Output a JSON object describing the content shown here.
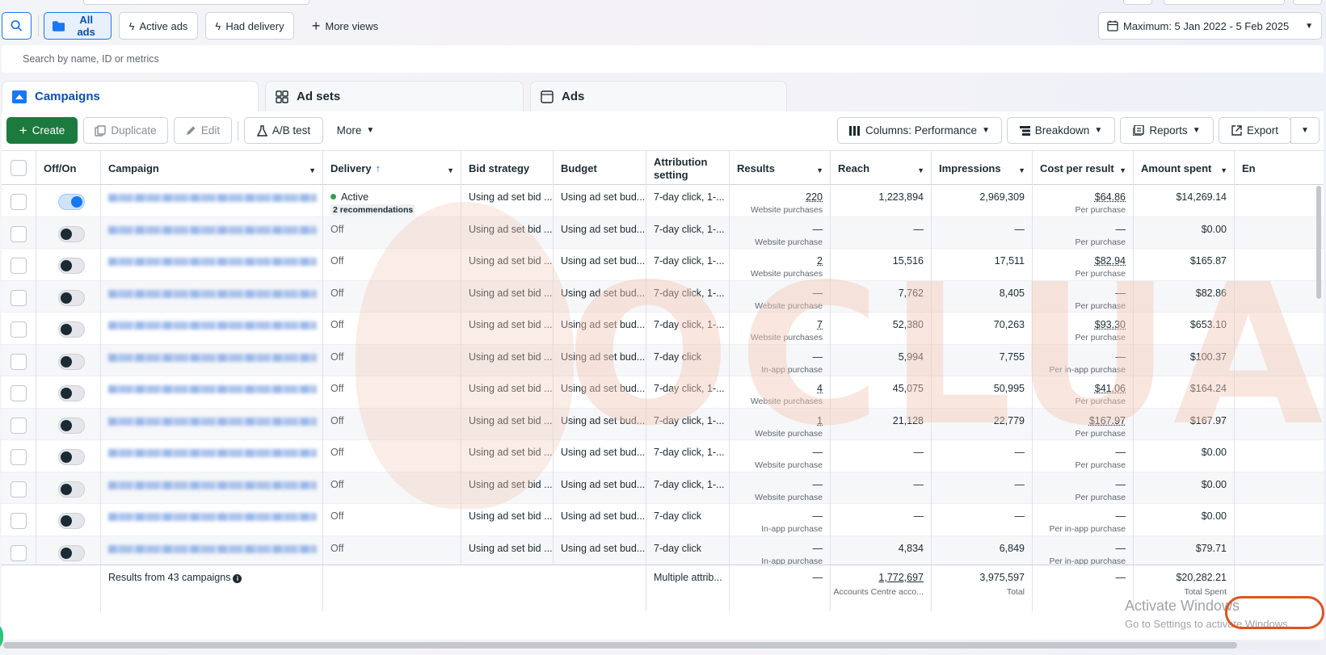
{
  "toolbar": {
    "all_ads": "All ads",
    "active_ads": "Active ads",
    "had_delivery": "Had delivery",
    "more_views": "More views",
    "date_range": "Maximum: 5 Jan 2022 - 5 Feb 2025"
  },
  "search": {
    "placeholder": "Search by name, ID or metrics"
  },
  "level_tabs": {
    "campaigns": "Campaigns",
    "ad_sets": "Ad sets",
    "ads": "Ads"
  },
  "actions": {
    "create": "Create",
    "duplicate": "Duplicate",
    "edit": "Edit",
    "ab_test": "A/B test",
    "more": "More",
    "columns": "Columns: Performance",
    "breakdown": "Breakdown",
    "reports": "Reports",
    "export": "Export"
  },
  "columns": {
    "off_on": "Off/On",
    "campaign": "Campaign",
    "delivery": "Delivery",
    "bid_strategy": "Bid strategy",
    "budget": "Budget",
    "attribution": "Attribution setting",
    "results": "Results",
    "reach": "Reach",
    "impressions": "Impressions",
    "cost_per_result": "Cost per result",
    "amount_spent": "Amount spent",
    "next_col": "En"
  },
  "rows": [
    {
      "on": true,
      "delivery": "Active",
      "recs": "2 recommendations",
      "bid": "Using ad set bid ...",
      "budget": "Using ad set bud...",
      "attr": "7-day click, 1-...",
      "results": "220",
      "results_sub": "Website purchases",
      "reach": "1,223,894",
      "impr": "2,969,309",
      "cpr": "$64.86",
      "cpr_sub": "Per purchase",
      "spent": "$14,269.14"
    },
    {
      "on": false,
      "delivery": "Off",
      "bid": "Using ad set bid ...",
      "budget": "Using ad set bud...",
      "attr": "7-day click, 1-...",
      "results": "—",
      "results_sub": "Website purchase",
      "reach": "—",
      "impr": "—",
      "cpr": "—",
      "cpr_sub": "Per purchase",
      "spent": "$0.00"
    },
    {
      "on": false,
      "delivery": "Off",
      "bid": "Using ad set bid ...",
      "budget": "Using ad set bud...",
      "attr": "7-day click, 1-...",
      "results": "2",
      "results_sub": "Website purchases",
      "reach": "15,516",
      "impr": "17,511",
      "cpr": "$82.94",
      "cpr_sub": "Per purchase",
      "spent": "$165.87"
    },
    {
      "on": false,
      "delivery": "Off",
      "bid": "Using ad set bid ...",
      "budget": "Using ad set bud...",
      "attr": "7-day click, 1-...",
      "results": "—",
      "results_sub": "Website purchase",
      "reach": "7,762",
      "impr": "8,405",
      "cpr": "—",
      "cpr_sub": "Per purchase",
      "spent": "$82.86"
    },
    {
      "on": false,
      "delivery": "Off",
      "bid": "Using ad set bid ...",
      "budget": "Using ad set bud...",
      "attr": "7-day click, 1-...",
      "results": "7",
      "results_sub": "Website purchases",
      "reach": "52,380",
      "impr": "70,263",
      "cpr": "$93.30",
      "cpr_sub": "Per purchase",
      "spent": "$653.10"
    },
    {
      "on": false,
      "delivery": "Off",
      "bid": "Using ad set bid ...",
      "budget": "Using ad set bud...",
      "attr": "7-day click",
      "results": "—",
      "results_sub": "In-app purchase",
      "reach": "5,994",
      "impr": "7,755",
      "cpr": "—",
      "cpr_sub": "Per in-app purchase",
      "spent": "$100.37"
    },
    {
      "on": false,
      "delivery": "Off",
      "bid": "Using ad set bid ...",
      "budget": "Using ad set bud...",
      "attr": "7-day click, 1-...",
      "results": "4",
      "results_sub": "Website purchases",
      "reach": "45,075",
      "impr": "50,995",
      "cpr": "$41.06",
      "cpr_sub": "Per purchase",
      "spent": "$164.24"
    },
    {
      "on": false,
      "delivery": "Off",
      "bid": "Using ad set bid ...",
      "budget": "Using ad set bud...",
      "attr": "7-day click, 1-...",
      "results": "1",
      "results_sub": "Website purchase",
      "reach": "21,128",
      "impr": "22,779",
      "cpr": "$167.97",
      "cpr_sub": "Per purchase",
      "spent": "$167.97"
    },
    {
      "on": false,
      "delivery": "Off",
      "bid": "Using ad set bid ...",
      "budget": "Using ad set bud...",
      "attr": "7-day click, 1-...",
      "results": "—",
      "results_sub": "Website purchase",
      "reach": "—",
      "impr": "—",
      "cpr": "—",
      "cpr_sub": "Per purchase",
      "spent": "$0.00"
    },
    {
      "on": false,
      "delivery": "Off",
      "bid": "Using ad set bid ...",
      "budget": "Using ad set bud...",
      "attr": "7-day click, 1-...",
      "results": "—",
      "results_sub": "Website purchase",
      "reach": "—",
      "impr": "—",
      "cpr": "—",
      "cpr_sub": "Per purchase",
      "spent": "$0.00"
    },
    {
      "on": false,
      "delivery": "Off",
      "bid": "Using ad set bid ...",
      "budget": "Using ad set bud...",
      "attr": "7-day click",
      "results": "—",
      "results_sub": "In-app purchase",
      "reach": "—",
      "impr": "—",
      "cpr": "—",
      "cpr_sub": "Per in-app purchase",
      "spent": "$0.00"
    },
    {
      "on": false,
      "delivery": "Off",
      "bid": "Using ad set bid ...",
      "budget": "Using ad set bud...",
      "attr": "7-day click",
      "results": "—",
      "results_sub": "In-app purchase",
      "reach": "4,834",
      "impr": "6,849",
      "cpr": "—",
      "cpr_sub": "Per in-app purchase",
      "spent": "$79.71"
    }
  ],
  "totals": {
    "label": "Results from 43 campaigns",
    "attribution": "Multiple attrib...",
    "results": "—",
    "reach": "1,772,697",
    "reach_sub": "Accounts Centre acco...",
    "impressions": "3,975,597",
    "impressions_sub": "Total",
    "cost_per_result": "—",
    "amount_spent": "$20,282.21",
    "amount_spent_sub": "Total Spent"
  },
  "overlay": {
    "watermark": "OCLUA",
    "activate_title": "Activate Windows",
    "activate_sub": "Go to Settings to activate Windows."
  },
  "colors": {
    "accent": "#1877f2",
    "create_green": "#1d7a3e",
    "highlight": "#e0531e"
  }
}
